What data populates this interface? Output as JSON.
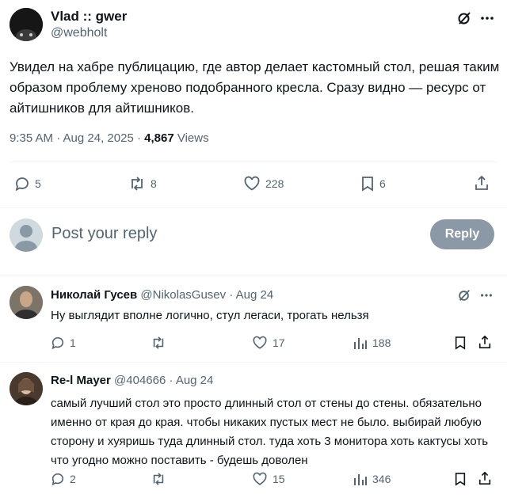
{
  "tweet": {
    "author_name": "Vlad :: gwer",
    "author_handle": "@webholt",
    "text": "Увидел на хабре публицацию, где автор делает кастомный стол, решая таким образом проблему хреново подобранного кресла. Сразу видно — ресурс от айтишников для айтишников.",
    "time": "9:35 AM · Aug 24, 2025 · ",
    "views_count": "4,867",
    "views_label": " Views",
    "replies": "5",
    "reposts": "8",
    "likes": "228",
    "bookmarks": "6"
  },
  "composer": {
    "placeholder": "Post your reply",
    "button_label": "Reply"
  },
  "replies": [
    {
      "author_name": "Николай Гусев",
      "meta": "@NikolasGusev · Aug 24",
      "text": "Ну выглядит вполне логично, стул легаси, трогать нельзя",
      "replies": "1",
      "reposts": "",
      "likes": "17",
      "views": "188"
    },
    {
      "author_name": "Re-l Mayer",
      "meta": "@404666 · Aug 24",
      "text": "самый лучший стол это просто длинный стол от стены до стены. обязательно именно от края до края. чтобы никаких пустых мест не было. выбирай любую сторону и хуяришь туда длинный стол. туда хоть 3 монитора хоть кактусы хоть что угодно можно поставить - будешь доволен",
      "replies": "2",
      "reposts": "",
      "likes": "15",
      "views": "346"
    }
  ],
  "colors": {
    "text": "#0f1419",
    "muted": "#536471",
    "divider": "#eff3f4",
    "reply_button_bg": "#8b98a5"
  }
}
